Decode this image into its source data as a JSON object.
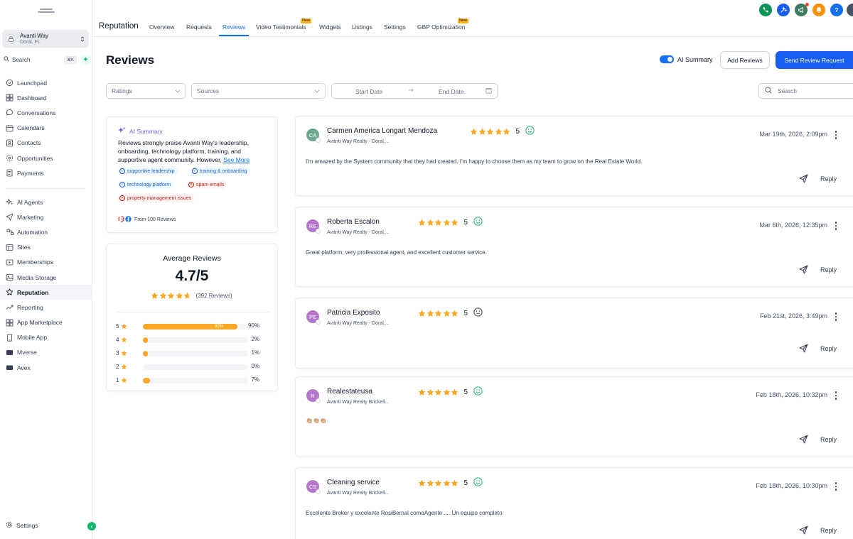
{
  "colors": {
    "accent": "#1570ef",
    "primary_button": "#155eef",
    "star": "#f9a825",
    "green": "#12b76a",
    "ai_purple": "#7a5af8"
  },
  "sidebar": {
    "account": {
      "name": "Avanti Way",
      "location": "Doral, FL"
    },
    "search": {
      "label": "Search",
      "shortcut": "⌘K"
    },
    "groups": [
      [
        {
          "label": "Launchpad",
          "icon": "launchpad-icon"
        },
        {
          "label": "Dashboard",
          "icon": "dashboard-icon"
        },
        {
          "label": "Conversations",
          "icon": "chat-icon"
        },
        {
          "label": "Calendars",
          "icon": "calendar-icon"
        },
        {
          "label": "Contacts",
          "icon": "contacts-icon"
        },
        {
          "label": "Opportunities",
          "icon": "opportunities-icon"
        },
        {
          "label": "Payments",
          "icon": "payments-icon"
        }
      ],
      [
        {
          "label": "AI Agents",
          "icon": "sparkle-icon"
        },
        {
          "label": "Marketing",
          "icon": "send-icon"
        },
        {
          "label": "Automation",
          "icon": "automation-icon"
        },
        {
          "label": "Sites",
          "icon": "sites-icon"
        },
        {
          "label": "Memberships",
          "icon": "memberships-icon"
        },
        {
          "label": "Media Storage",
          "icon": "media-icon"
        },
        {
          "label": "Reputation",
          "icon": "star-icon",
          "active": true
        },
        {
          "label": "Reporting",
          "icon": "reporting-icon"
        },
        {
          "label": "App Marketplace",
          "icon": "marketplace-icon"
        },
        {
          "label": "Mobile App",
          "icon": "mobile-icon"
        },
        {
          "label": "Mverse",
          "icon": "mverse-icon"
        },
        {
          "label": "Avex",
          "icon": "avex-icon"
        }
      ]
    ],
    "settings_label": "Settings"
  },
  "header": {
    "section_title": "Reputation",
    "tabs": [
      {
        "label": "Overview"
      },
      {
        "label": "Requests"
      },
      {
        "label": "Reviews",
        "active": true
      },
      {
        "label": "Video Testimonials",
        "badge": "New"
      },
      {
        "label": "Widgets"
      },
      {
        "label": "Listings"
      },
      {
        "label": "Settings"
      },
      {
        "label": "GBP Optimization",
        "badge": "New"
      }
    ],
    "top_icons": [
      "phone-icon",
      "magic-icon",
      "megaphone-icon",
      "bell-icon",
      "help-icon"
    ]
  },
  "page": {
    "title": "Reviews",
    "ai_summary_toggle": "AI Summary",
    "add_reviews_label": "Add Reviews",
    "send_request_label": "Send Review Request"
  },
  "filters": {
    "ratings_placeholder": "Ratings",
    "sources_placeholder": "Sources",
    "start_date_placeholder": "Start Date",
    "end_date_placeholder": "End Date",
    "search_placeholder": "Search"
  },
  "ai_summary": {
    "title": "AI Summary",
    "text_line1": "Reviews strongly praise Avanti Way's leadership,",
    "text_line2": "onboarding, technology platform, training, and",
    "text_line3": "supportive agent community. However,",
    "see_more": "See More",
    "positive_tags": [
      "supportive leadership",
      "training & onboarding",
      "technology platform"
    ],
    "negative_tags": [
      "spam emails",
      "property management issues"
    ],
    "footer": "From 100 Reviews"
  },
  "average": {
    "label": "Average Reviews",
    "value": "4.7/5",
    "rating": 4.7,
    "count_label": "(392 Reviews)",
    "distribution": [
      {
        "stars": "5",
        "percent": 90,
        "label": "90%",
        "inner_label": "90%"
      },
      {
        "stars": "4",
        "percent": 2,
        "label": "2%"
      },
      {
        "stars": "3",
        "percent": 1,
        "label": "1%"
      },
      {
        "stars": "2",
        "percent": 0,
        "label": "0%"
      },
      {
        "stars": "1",
        "percent": 7,
        "label": "7%"
      }
    ]
  },
  "reviews": [
    {
      "initials": "CA",
      "avatar_color": "#6ca88e",
      "name": "Carmen America Longart Mendoza",
      "source": "Avanti Way Realty - Doral,...",
      "rating": "5",
      "sentiment": "positive",
      "date": "Mar 19th, 2026, 2:09pm",
      "text": "I'm amazed by the System community that they had created. I'm happy to choose them as my team to grow on the Real Estate World.",
      "reply_label": "Reply"
    },
    {
      "initials": "RE",
      "avatar_color": "#b476c9",
      "name": "Roberta Escalon",
      "source": "Avanti Way Realty - Doral,...",
      "rating": "5",
      "sentiment": "positive",
      "date": "Mar 6th, 2026, 12:35pm",
      "text": "Great platform, very professional agent, and excellent customer service.",
      "reply_label": "Reply"
    },
    {
      "initials": "PE",
      "avatar_color": "#b476c9",
      "name": "Patricia Exposito",
      "source": "Avanti Way Realty - Doral,...",
      "rating": "5",
      "sentiment": "neutral",
      "date": "Feb 21st, 2026, 3:49pm",
      "text": "",
      "reply_label": "Reply"
    },
    {
      "initials": "R",
      "avatar_color": "#b476c9",
      "name": "Realestateusa",
      "source": "Avanti Way Realty Brickell...",
      "rating": "5",
      "sentiment": "positive",
      "date": "Feb 18th, 2026, 10:32pm",
      "text": "👏🏼👏🏼👏🏼",
      "reply_label": "Reply"
    },
    {
      "initials": "CS",
      "avatar_color": "#b476c9",
      "name": "Cleaning service",
      "source": "Avanti Way Realty Brickell...",
      "rating": "5",
      "sentiment": "positive",
      "date": "Feb 18th, 2026, 10:30pm",
      "text": "Excelente Broker y excelente RosiBernal comoAgente .... Un equipo completo",
      "reply_label": "Reply"
    }
  ]
}
